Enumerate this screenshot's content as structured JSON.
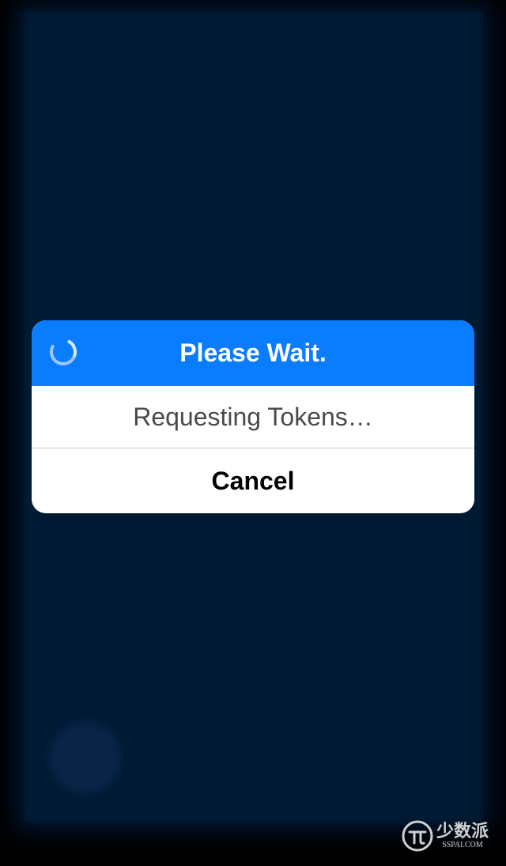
{
  "background": {
    "title": "",
    "description": ""
  },
  "alert": {
    "title": "Please Wait.",
    "message": "Requesting Tokens…",
    "cancel_label": "Cancel",
    "header_color": "#0a7cfe"
  },
  "watermark": {
    "name": "少数派",
    "domain": "SSPAI.COM"
  },
  "colors": {
    "screen_bg": "#000000",
    "app_bg": "#001a33",
    "accent": "#0a7cfe"
  },
  "icons": {
    "spinner": "activity-spinner-icon",
    "watermark_logo": "sspai-logo-icon"
  }
}
